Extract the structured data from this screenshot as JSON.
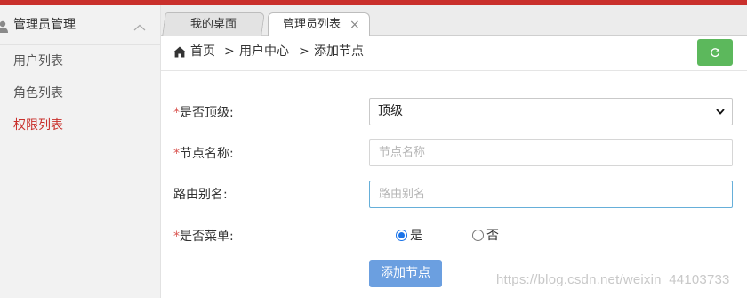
{
  "sidebar": {
    "menu_title": "管理员管理",
    "items": [
      {
        "label": "用户列表"
      },
      {
        "label": "角色列表"
      },
      {
        "label": "权限列表",
        "active": true
      }
    ]
  },
  "tabs": [
    {
      "label": "我的桌面"
    },
    {
      "label": "管理员列表",
      "close": "×",
      "active": true
    }
  ],
  "breadcrumb": {
    "items": [
      "首页",
      "用户中心",
      "添加节点"
    ],
    "separator": ">"
  },
  "form": {
    "is_top": {
      "required_mark": "*",
      "label": "是否顶级:",
      "selected": "顶级"
    },
    "node_name": {
      "required_mark": "*",
      "label": "节点名称:",
      "placeholder": "节点名称",
      "value": ""
    },
    "route_alias": {
      "label": "路由别名:",
      "placeholder": "路由别名",
      "value": ""
    },
    "is_menu": {
      "required_mark": "*",
      "label": "是否菜单:",
      "options": [
        "是",
        "否"
      ],
      "selected": "是"
    },
    "submit_label": "添加节点"
  },
  "watermark": "https://blog.csdn.net/weixin_44103733",
  "colors": {
    "brand_red": "#c9302c",
    "refresh_green": "#5cb85c",
    "submit_blue": "#6b9fe0",
    "required_red": "#d9534f"
  }
}
